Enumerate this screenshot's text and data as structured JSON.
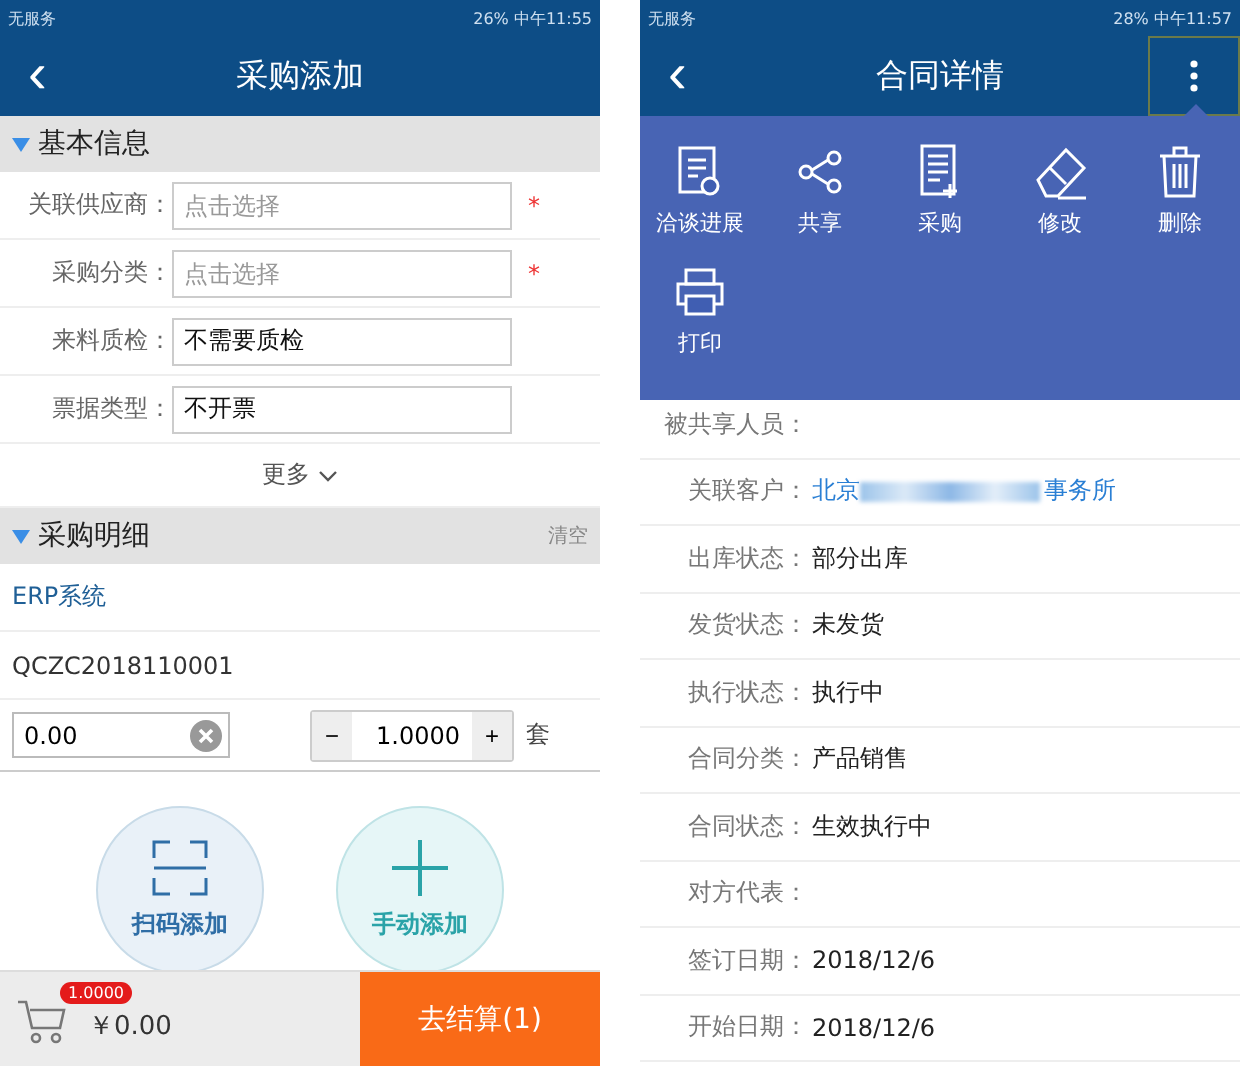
{
  "left_screen": {
    "status_bar": {
      "carrier": "无服务",
      "battery": "26%",
      "time": "中午11:55"
    },
    "header": {
      "back": "‹",
      "title": "采购添加"
    },
    "basic_section": {
      "title": "基本信息",
      "expanded": true
    },
    "fields": [
      {
        "label": "关联供应商：",
        "placeholder": "点击选择",
        "required": true,
        "mark": "*"
      },
      {
        "label": "采购分类：",
        "placeholder": "点击选择",
        "required": true,
        "mark": "*"
      },
      {
        "label": "来料质检：",
        "value": "不需要质检",
        "required": false
      },
      {
        "label": "票据类型：",
        "value": "不开票",
        "required": false
      }
    ],
    "more": "更多",
    "detail_section": {
      "title": "采购明细",
      "expanded": true,
      "action": "清空"
    },
    "source": "ERP系统",
    "item_code": "QCZC2018110001",
    "price": {
      "value": "0.00"
    },
    "quantity": {
      "minus": "−",
      "value": "1.0000",
      "plus": "+",
      "unit": "套"
    },
    "add_buttons": [
      {
        "kind": "scan",
        "label": "扫码添加"
      },
      {
        "kind": "manual",
        "label": "手动添加"
      }
    ],
    "footer": {
      "badge": "1.0000",
      "total": "￥0.00",
      "checkout": "去结算(1)"
    }
  },
  "right_screen": {
    "status_bar": {
      "carrier": "无服务",
      "battery": "28%",
      "time": "中午11:57"
    },
    "header": {
      "back": "‹",
      "title": "合同详情",
      "menu_open": true
    },
    "menu": [
      {
        "kind": "progress",
        "label": "洽谈进展"
      },
      {
        "kind": "share",
        "label": "共享"
      },
      {
        "kind": "purchase",
        "label": "采购"
      },
      {
        "kind": "edit",
        "label": "修改"
      },
      {
        "kind": "delete",
        "label": "删除"
      },
      {
        "kind": "print",
        "label": "打印"
      }
    ],
    "rows": [
      {
        "label": "被共享人员："
      },
      {
        "kind": "link",
        "label": "关联客户：",
        "value": "北京",
        "value_end": "事务所"
      },
      {
        "label": "出库状态：",
        "value": "部分出库"
      },
      {
        "label": "发货状态：",
        "value": "未发货"
      },
      {
        "label": "执行状态：",
        "value": "执行中"
      },
      {
        "label": "合同分类：",
        "value": "产品销售"
      },
      {
        "label": "合同状态：",
        "value": "生效执行中"
      },
      {
        "label": "对方代表："
      },
      {
        "label": "签订日期：",
        "value": "2018/12/6"
      },
      {
        "label": "开始日期：",
        "value": "2018/12/6"
      }
    ]
  }
}
